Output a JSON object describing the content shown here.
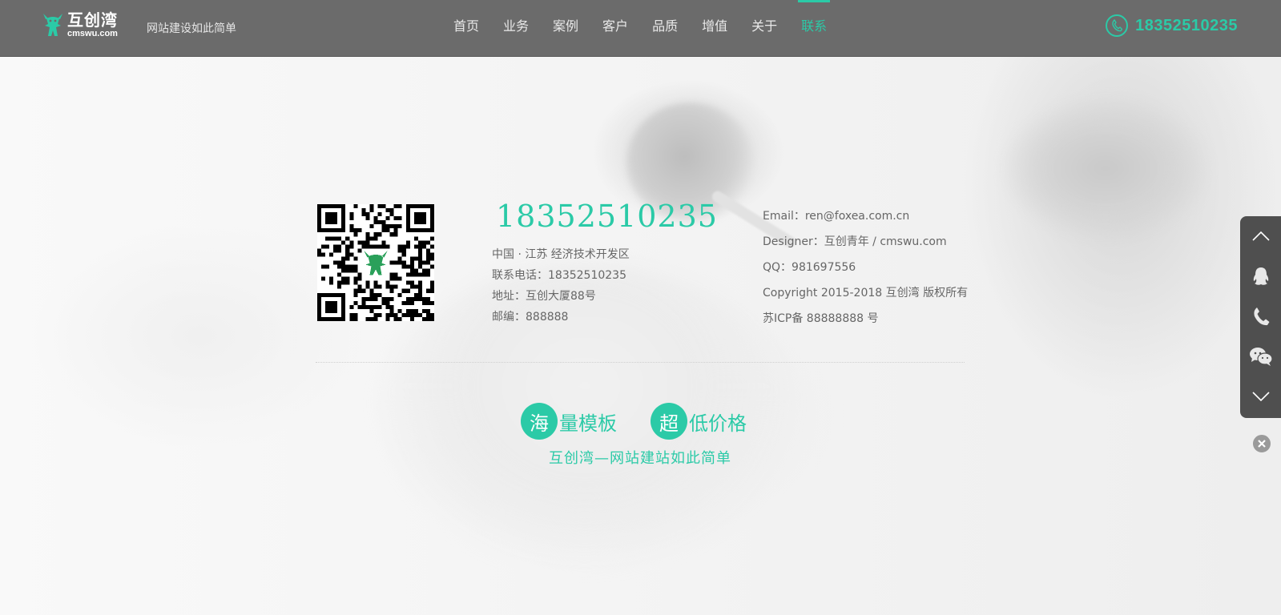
{
  "header": {
    "logo_name": "互创湾",
    "logo_domain": "cmswu.com",
    "slogan": "网站建设如此简单",
    "nav": [
      "首页",
      "业务",
      "案例",
      "客户",
      "品质",
      "增值",
      "关于",
      "联系"
    ],
    "active_nav": "联系",
    "phone": "18352510235",
    "accent_color": "#2bcaa7"
  },
  "contact": {
    "big_phone": "18352510235",
    "address_lines": [
      "中国 · 江苏   经济技术开发区",
      "联系电话：18352510235",
      "地址：互创大厦88号",
      "邮编：888888"
    ],
    "meta_lines": [
      "Email：ren@foxea.com.cn",
      "Designer：互创青年 / cmswu.com",
      "QQ：981697556",
      "Copyright 2015-2018   互创湾 版权所有",
      "苏ICP备 88888888 号"
    ]
  },
  "promo": {
    "tag1_first": "海",
    "tag1_rest": "量模板",
    "tag2_first": "超",
    "tag2_rest": "低价格",
    "tagline": "互创湾—网站建站如此简单"
  },
  "float_bar": {
    "items": [
      "chevron-up-icon",
      "qq-penguin-icon",
      "phone-icon",
      "wechat-icon",
      "chevron-down-icon"
    ],
    "close": "close-icon"
  }
}
